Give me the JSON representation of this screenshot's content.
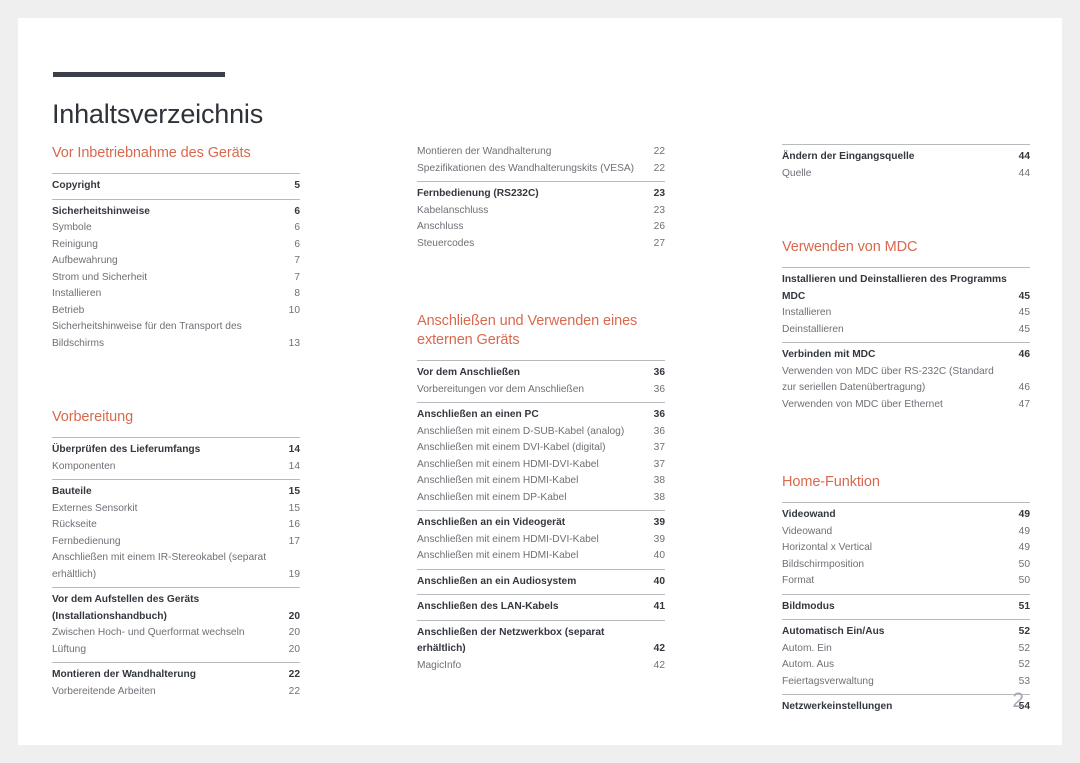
{
  "document": {
    "title": "Inhaltsverzeichnis",
    "folio": "2",
    "accent_color": "#d9694e",
    "rule_color": "#3b3f48",
    "title_color": "#2e3239"
  },
  "columns": [
    {
      "id": "column-1",
      "blocks": [
        {
          "type": "heading",
          "text": "Vor Inbetriebnahme des Geräts"
        },
        {
          "type": "group",
          "rule": true,
          "entries": [
            {
              "level": 1,
              "label": "Copyright",
              "page": "5"
            }
          ]
        },
        {
          "type": "group",
          "rule": true,
          "entries": [
            {
              "level": 1,
              "label": "Sicherheitshinweise",
              "page": "6"
            },
            {
              "level": 2,
              "label": "Symbole",
              "page": "6"
            },
            {
              "level": 2,
              "label": "Reinigung",
              "page": "6"
            },
            {
              "level": 2,
              "label": "Aufbewahrung",
              "page": "7"
            },
            {
              "level": 2,
              "label": "Strom und Sicherheit",
              "page": "7"
            },
            {
              "level": 2,
              "label": "Installieren",
              "page": "8"
            },
            {
              "level": 2,
              "label": "Betrieb",
              "page": "10"
            },
            {
              "level": 2,
              "label": "Sicherheitshinweise für den Transport des Bildschirms",
              "page": "13"
            }
          ]
        },
        {
          "type": "heading",
          "spacing": "spaced",
          "text": "Vorbereitung"
        },
        {
          "type": "group",
          "rule": true,
          "entries": [
            {
              "level": 1,
              "label": "Überprüfen des Lieferumfangs",
              "page": "14"
            },
            {
              "level": 2,
              "label": "Komponenten",
              "page": "14"
            }
          ]
        },
        {
          "type": "group",
          "rule": true,
          "entries": [
            {
              "level": 1,
              "label": "Bauteile",
              "page": "15"
            },
            {
              "level": 2,
              "label": "Externes Sensorkit",
              "page": "15"
            },
            {
              "level": 2,
              "label": "Rückseite",
              "page": "16"
            },
            {
              "level": 2,
              "label": "Fernbedienung",
              "page": "17"
            },
            {
              "level": 2,
              "label": "Anschließen mit einem IR-Stereokabel (separat erhältlich)",
              "page": "19"
            }
          ]
        },
        {
          "type": "group",
          "rule": true,
          "entries": [
            {
              "level": 1,
              "label": "Vor dem Aufstellen des Geräts (Installationshandbuch)",
              "page": "20"
            },
            {
              "level": 2,
              "label": "Zwischen Hoch- und Querformat wechseln",
              "page": "20"
            },
            {
              "level": 2,
              "label": "Lüftung",
              "page": "20"
            }
          ]
        },
        {
          "type": "group",
          "rule": true,
          "entries": [
            {
              "level": 1,
              "label": "Montieren der Wandhalterung",
              "page": "22"
            },
            {
              "level": 2,
              "label": "Vorbereitende Arbeiten",
              "page": "22"
            }
          ]
        }
      ]
    },
    {
      "id": "column-2",
      "blocks": [
        {
          "type": "group",
          "rule": false,
          "entries": [
            {
              "level": 2,
              "label": "Montieren der Wandhalterung",
              "page": "22"
            },
            {
              "level": 2,
              "label": "Spezifikationen des Wandhalterungskits (VESA)",
              "page": "22"
            }
          ]
        },
        {
          "type": "group",
          "rule": true,
          "entries": [
            {
              "level": 1,
              "label": "Fernbedienung (RS232C)",
              "page": "23"
            },
            {
              "level": 2,
              "label": "Kabelanschluss",
              "page": "23"
            },
            {
              "level": 2,
              "label": "Anschluss",
              "page": "26"
            },
            {
              "level": 2,
              "label": "Steuercodes",
              "page": "27"
            }
          ]
        },
        {
          "type": "heading",
          "spacing": "spaced-lg",
          "text": "Anschließen und Verwenden eines externen Geräts"
        },
        {
          "type": "group",
          "rule": true,
          "entries": [
            {
              "level": 1,
              "label": "Vor dem Anschließen",
              "page": "36"
            },
            {
              "level": 2,
              "label": "Vorbereitungen vor dem Anschließen",
              "page": "36"
            }
          ]
        },
        {
          "type": "group",
          "rule": true,
          "entries": [
            {
              "level": 1,
              "label": "Anschließen an einen PC",
              "page": "36"
            },
            {
              "level": 2,
              "label": "Anschließen mit einem D-SUB-Kabel (analog)",
              "page": "36"
            },
            {
              "level": 2,
              "label": "Anschließen mit einem DVI-Kabel (digital)",
              "page": "37"
            },
            {
              "level": 2,
              "label": "Anschließen mit einem HDMI-DVI-Kabel",
              "page": "37"
            },
            {
              "level": 2,
              "label": "Anschließen mit einem HDMI-Kabel",
              "page": "38"
            },
            {
              "level": 2,
              "label": "Anschließen mit einem DP-Kabel",
              "page": "38"
            }
          ]
        },
        {
          "type": "group",
          "rule": true,
          "entries": [
            {
              "level": 1,
              "label": "Anschließen an ein Videogerät",
              "page": "39"
            },
            {
              "level": 2,
              "label": "Anschließen mit einem HDMI-DVI-Kabel",
              "page": "39"
            },
            {
              "level": 2,
              "label": "Anschließen mit einem HDMI-Kabel",
              "page": "40"
            }
          ]
        },
        {
          "type": "group",
          "rule": true,
          "entries": [
            {
              "level": 1,
              "label": "Anschließen an ein Audiosystem",
              "page": "40"
            }
          ]
        },
        {
          "type": "group",
          "rule": true,
          "entries": [
            {
              "level": 1,
              "label": "Anschließen des LAN-Kabels",
              "page": "41"
            }
          ]
        },
        {
          "type": "group",
          "rule": true,
          "entries": [
            {
              "level": 1,
              "label": "Anschließen der Netzwerkbox (separat erhältlich)",
              "page": "42"
            },
            {
              "level": 2,
              "label": "MagicInfo",
              "page": "42"
            }
          ]
        }
      ]
    },
    {
      "id": "column-3",
      "blocks": [
        {
          "type": "group",
          "rule": true,
          "entries": [
            {
              "level": 1,
              "label": "Ändern der Eingangsquelle",
              "page": "44"
            },
            {
              "level": 2,
              "label": "Quelle",
              "page": "44"
            }
          ]
        },
        {
          "type": "heading",
          "spacing": "spaced",
          "text": "Verwenden von MDC"
        },
        {
          "type": "group",
          "rule": true,
          "entries": [
            {
              "level": 1,
              "label": "Installieren und Deinstallieren des Programms MDC",
              "page": "45"
            },
            {
              "level": 2,
              "label": "Installieren",
              "page": "45"
            },
            {
              "level": 2,
              "label": "Deinstallieren",
              "page": "45"
            }
          ]
        },
        {
          "type": "group",
          "rule": true,
          "entries": [
            {
              "level": 1,
              "label": "Verbinden mit MDC",
              "page": "46"
            },
            {
              "level": 2,
              "label": "Verwenden von MDC über RS-232C (Standard zur seriellen Datenübertragung)",
              "page": "46"
            },
            {
              "level": 2,
              "label": "Verwenden von MDC über Ethernet",
              "page": "47"
            }
          ]
        },
        {
          "type": "heading",
          "spacing": "spaced-lg",
          "text": "Home-Funktion"
        },
        {
          "type": "group",
          "rule": true,
          "entries": [
            {
              "level": 1,
              "label": "Videowand",
              "page": "49"
            },
            {
              "level": 2,
              "label": "Videowand",
              "page": "49"
            },
            {
              "level": 2,
              "label": "Horizontal x Vertical",
              "page": "49"
            },
            {
              "level": 2,
              "label": "Bildschirmposition",
              "page": "50"
            },
            {
              "level": 2,
              "label": "Format",
              "page": "50"
            }
          ]
        },
        {
          "type": "group",
          "rule": true,
          "entries": [
            {
              "level": 1,
              "label": "Bildmodus",
              "page": "51"
            }
          ]
        },
        {
          "type": "group",
          "rule": true,
          "entries": [
            {
              "level": 1,
              "label": "Automatisch Ein/Aus",
              "page": "52"
            },
            {
              "level": 2,
              "label": "Autom. Ein",
              "page": "52"
            },
            {
              "level": 2,
              "label": "Autom. Aus",
              "page": "52"
            },
            {
              "level": 2,
              "label": "Feiertagsverwaltung",
              "page": "53"
            }
          ]
        },
        {
          "type": "group",
          "rule": true,
          "entries": [
            {
              "level": 1,
              "label": "Netzwerkeinstellungen",
              "page": "54"
            }
          ]
        }
      ]
    }
  ]
}
